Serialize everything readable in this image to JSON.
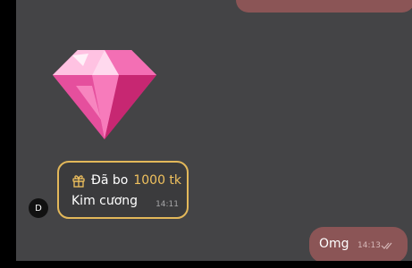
{
  "conversation": {
    "gift_message": {
      "title": "Đã bo",
      "amount": "1000 tk",
      "gift_name": "Kim cương",
      "time": "14:11",
      "sender_initial": "D"
    },
    "outgoing_message": {
      "text": "Omg",
      "time": "14:13",
      "status_icon": "double-check-icon"
    }
  },
  "colors": {
    "chat_background": "#444446",
    "outgoing_bubble": "#8b5556",
    "gift_border": "#e3b85a",
    "gift_amount": "#f0c15e"
  }
}
